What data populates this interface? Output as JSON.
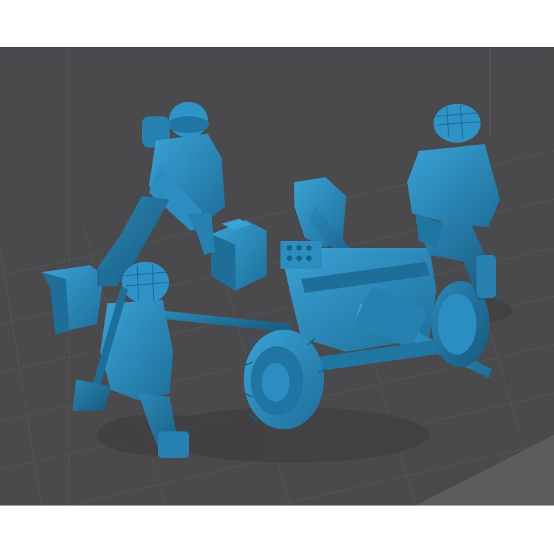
{
  "viewport": {
    "background_color": "#4a4a4c",
    "model_color": "#2a8fc0",
    "grid_color": "#5a5a5c",
    "shadow_color": "#3a3a3c"
  },
  "scene": {
    "objects": [
      {
        "name": "anti-tank-gun",
        "parts": [
          "gun-shield",
          "barrel",
          "left-wheel",
          "right-wheel",
          "trail-leg",
          "trail-spade"
        ]
      },
      {
        "name": "soldier-standing-helmet"
      },
      {
        "name": "soldier-kneeling-right"
      },
      {
        "name": "soldier-kneeling-left"
      },
      {
        "name": "ammo-crate"
      }
    ]
  }
}
